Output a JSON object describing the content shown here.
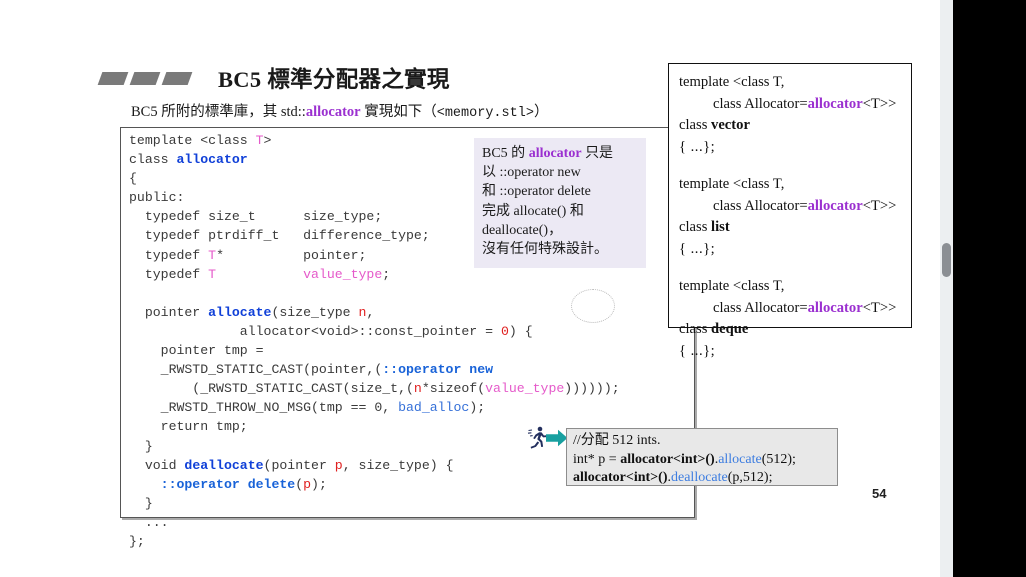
{
  "slide": {
    "title": "BC5 標準分配器之實現",
    "subtitle_pre": "BC5 所附的標準庫，其 std::",
    "subtitle_kw": "allocator",
    "subtitle_post": " 實現如下（",
    "subtitle_mono": "<memory.stl>",
    "subtitle_end": "）",
    "page_number": "54"
  },
  "code_block": {
    "lines": [
      "template <class T>",
      "class allocator",
      "{",
      "public:",
      "  typedef size_t      size_type;",
      "  typedef ptrdiff_t   difference_type;",
      "  typedef T*          pointer;",
      "  typedef T           value_type;",
      "",
      "  pointer allocate(size_type n,",
      "              allocator<void>::const_pointer = 0) {",
      "    pointer tmp =",
      "    _RWSTD_STATIC_CAST(pointer,(::operator new",
      "        (_RWSTD_STATIC_CAST(size_t,(n*sizeof(value_type))))));",
      "    _RWSTD_THROW_NO_MSG(tmp == 0, bad_alloc);",
      "    return tmp;",
      "  }",
      "  void deallocate(pointer p, size_type) {",
      "    ::operator delete(p);",
      "  }",
      "  ...",
      "};"
    ],
    "annotation_circle_target": "= 0)"
  },
  "note_callout": {
    "line1_pre": "BC5 的 ",
    "line1_kw": "allocator",
    "line1_post": " 只是",
    "line2": "以 ::operator new",
    "line3": "和 ::operator delete",
    "line4": "完成 allocate() 和",
    "line5": "deallocate()，",
    "line6": "沒有任何特殊設計。"
  },
  "templates_box": {
    "entries": [
      {
        "l1": "template <class T,",
        "l2_pre": "class Allocator=",
        "l2_kw": "allocator",
        "l2_post": "<T>>",
        "l3_pre": "class ",
        "l3_name": "vector",
        "l4": "{ ...};"
      },
      {
        "l1": "template <class T,",
        "l2_pre": "class Allocator=",
        "l2_kw": "allocator",
        "l2_post": "<T>>",
        "l3_pre": "class ",
        "l3_name": "list",
        "l4": "{ ...};"
      },
      {
        "l1": "template <class T,",
        "l2_pre": "class Allocator=",
        "l2_kw": "allocator",
        "l2_post": "<T>>",
        "l3_pre": "class ",
        "l3_name": "deque",
        "l4": "{ ...};"
      }
    ]
  },
  "example_box": {
    "line1": "//分配 512 ints.",
    "line2_a": "int* p = ",
    "line2_b": "allocator<int>()",
    "line2_c": ".",
    "line2_d": "allocate",
    "line2_e": "(512);",
    "line3_a": "allocator<int>()",
    "line3_b": ".",
    "line3_c": "deallocate",
    "line3_d": "(p,512);"
  },
  "icons": {
    "runner": "runner-icon",
    "arrow": "right-arrow-icon"
  },
  "colors": {
    "accent_purple": "#9b30d0",
    "keyword_blue": "#1040d8",
    "template_pink": "#e55aca",
    "red": "#e02020",
    "callout_bg": "#ece9f4",
    "example_bg": "#e8e8e8",
    "arrow_teal": "#18a0a0"
  }
}
